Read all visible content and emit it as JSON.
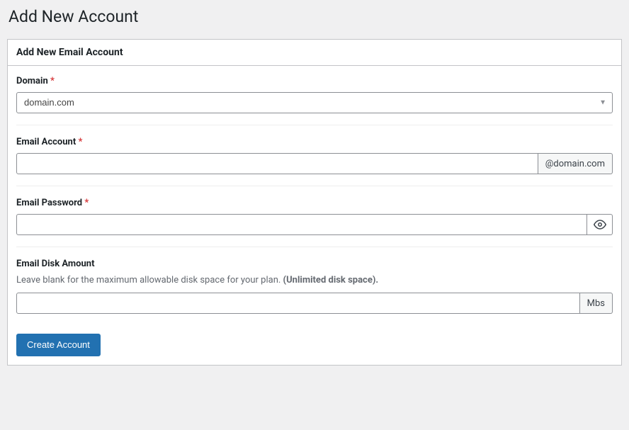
{
  "page": {
    "title": "Add New Account"
  },
  "panel": {
    "header": "Add New Email Account"
  },
  "form": {
    "domain": {
      "label": "Domain",
      "required_marker": "*",
      "selected": "domain.com"
    },
    "email_account": {
      "label": "Email Account",
      "required_marker": "*",
      "value": "",
      "suffix": "@domain.com"
    },
    "email_password": {
      "label": "Email Password",
      "required_marker": "*",
      "value": ""
    },
    "disk_amount": {
      "label": "Email Disk Amount",
      "help_prefix": "Leave blank for the maximum allowable disk space for your plan. ",
      "help_bold": "(Unlimited disk space).",
      "value": "",
      "unit": "Mbs"
    },
    "submit": {
      "label": "Create Account"
    }
  }
}
